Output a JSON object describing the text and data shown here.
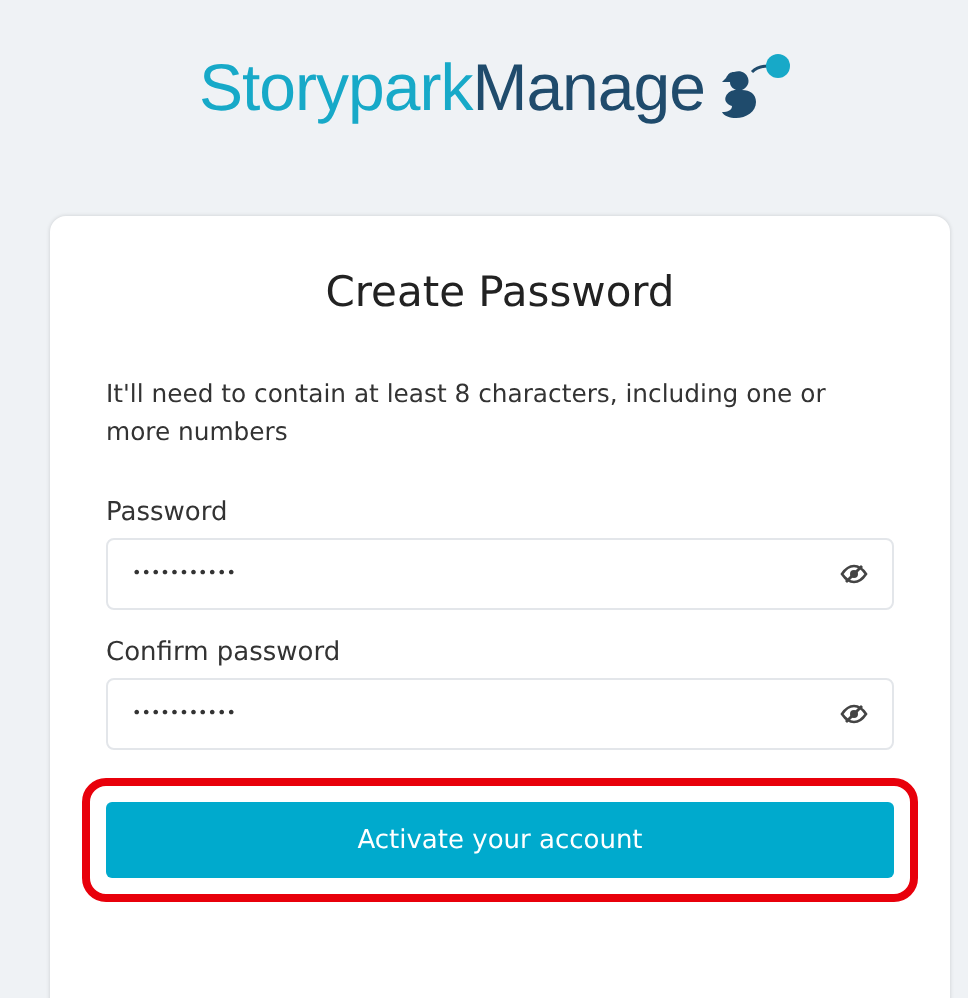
{
  "logo": {
    "brand": "Storypark",
    "product": "Manage"
  },
  "card": {
    "title": "Create Password",
    "description": "It'll need to contain at least 8 characters, including one or more numbers",
    "fields": [
      {
        "label": "Password",
        "value": "•••••••••••"
      },
      {
        "label": "Confirm password",
        "value": "•••••••••••"
      }
    ],
    "button": {
      "label": "Activate your account",
      "highlighted": true
    }
  }
}
